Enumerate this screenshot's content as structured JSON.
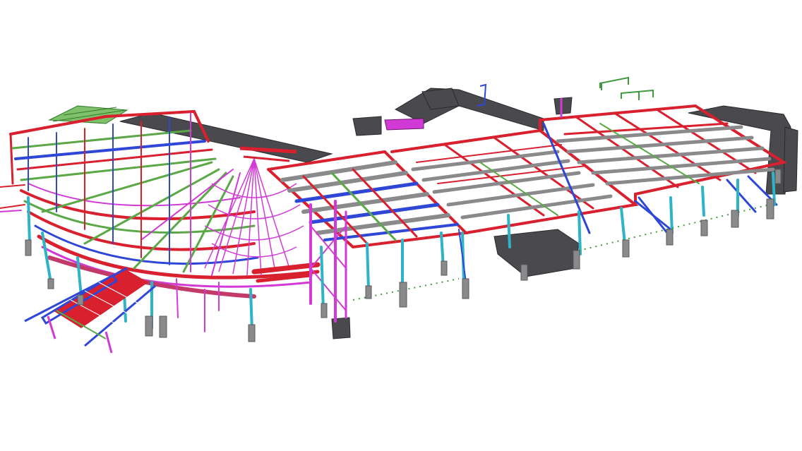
{
  "scene": {
    "background": "#ffffff",
    "palette": {
      "beam_red": "#d8202e",
      "beam_blue": "#2f47d6",
      "beam_green": "#5aa846",
      "member_magenta": "#d23ad6",
      "column_cyan": "#2fb3c6",
      "concrete_grey": "#4a4a4e",
      "pier_grey": "#8a8a8c",
      "marker_green": "#3e9a3a",
      "outline_dark": "#2a2a2e"
    },
    "components": [
      "curved-wing-frame",
      "radial-fan-structure",
      "central-hall-frame",
      "east-wing-roof-grid",
      "concrete-spine-walls",
      "entrance-stair-ramp",
      "foundation-piers"
    ]
  }
}
